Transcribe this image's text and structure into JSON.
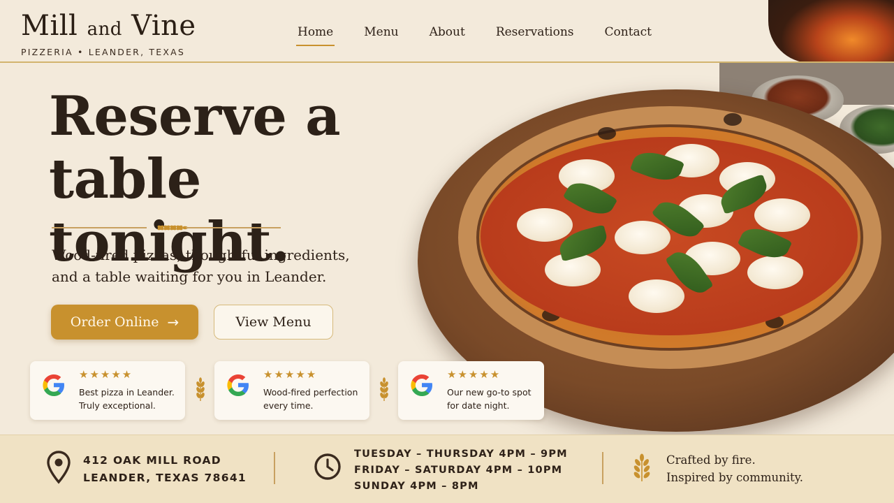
{
  "brand": {
    "name_part1": "Mill",
    "name_amp": "and",
    "name_part2": "Vine",
    "subtitle": "PIZZERIA • LEANDER, TEXAS"
  },
  "nav": {
    "items": [
      {
        "label": "Home",
        "active": true
      },
      {
        "label": "Menu",
        "active": false
      },
      {
        "label": "About",
        "active": false
      },
      {
        "label": "Reservations",
        "active": false
      },
      {
        "label": "Contact",
        "active": false
      }
    ]
  },
  "hero": {
    "headline_line1": "Reserve a",
    "headline_line2": "table tonight.",
    "subtitle_line1": "Wood-fired pizzas, thoughtful ingredients,",
    "subtitle_line2": "and a table waiting for you in Leander.",
    "primary_button": "Order Online",
    "primary_button_icon": "arrow-right-icon",
    "secondary_button": "View Menu"
  },
  "reviews": [
    {
      "stars": "★★★★★",
      "rating": 5,
      "quote_line1": "Best pizza in Leander.",
      "quote_line2": "Truly exceptional.",
      "icon": "google-icon"
    },
    {
      "stars": "★★★★★",
      "rating": 5,
      "quote_line1": "Wood-fired perfection",
      "quote_line2": "every time.",
      "icon": "google-icon"
    },
    {
      "stars": "★★★★★",
      "rating": 5,
      "quote_line1": "Our new go-to spot",
      "quote_line2": "for date night.",
      "icon": "google-icon"
    }
  ],
  "info": {
    "address_line1": "412 OAK MILL ROAD",
    "address_line2": "LEANDER, TEXAS 78641",
    "hours": [
      "TUESDAY – THURSDAY 4PM – 9PM",
      "FRIDAY – SATURDAY 4PM – 10PM",
      "SUNDAY 4PM – 8PM"
    ],
    "tagline_line1": "Crafted by fire.",
    "tagline_line2": "Inspired by community."
  },
  "colors": {
    "background": "#f3eadb",
    "accent_gold": "#c8912e",
    "text_dark": "#2e2118",
    "infobar_bg": "#f0e2c4"
  }
}
